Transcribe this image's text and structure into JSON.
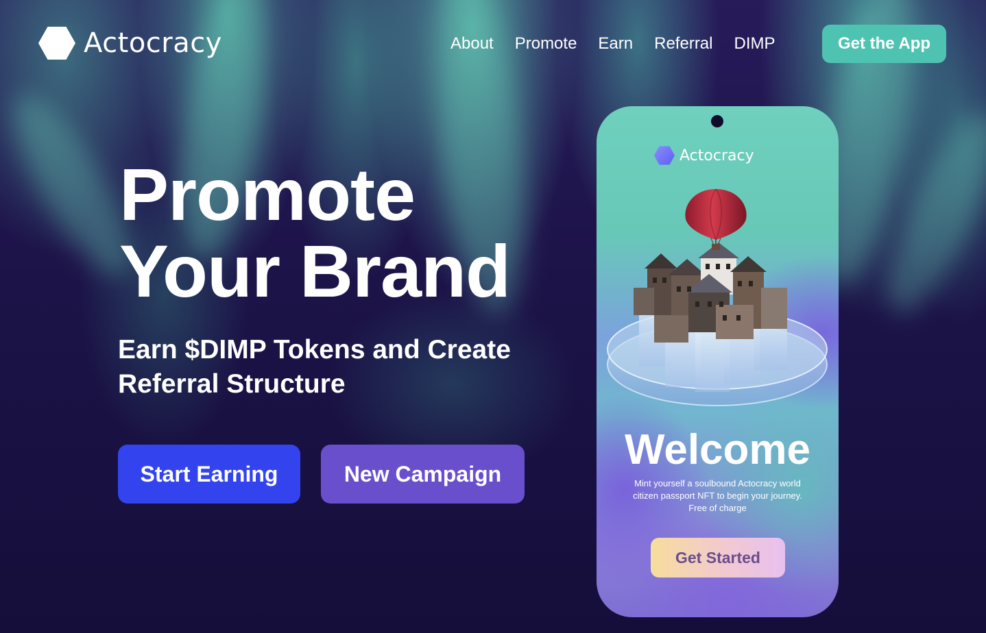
{
  "brand": {
    "name": "Actocracy",
    "logo_icon": "hexagon-logo-icon"
  },
  "nav": {
    "links": [
      "About",
      "Promote",
      "Earn",
      "Referral",
      "DIMP"
    ],
    "cta": "Get the App"
  },
  "hero": {
    "title_line1": "Promote",
    "title_line2": "Your Brand",
    "subtitle": "Earn $DIMP Tokens and Create Referral Structure",
    "primary_button": "Start Earning",
    "secondary_button": "New Campaign"
  },
  "phone": {
    "brand": "Actocracy",
    "illustration": "hot-air-balloon-village-illustration",
    "welcome": "Welcome",
    "description": "Mint yourself a soulbound Actocracy world citizen passport NFT to begin your journey. Free of charge",
    "button": "Get Started"
  },
  "colors": {
    "background": "#15103a",
    "accent_teal": "#4fc3b2",
    "primary_blue": "#3344ef",
    "secondary_purple": "#6a4fcd"
  }
}
